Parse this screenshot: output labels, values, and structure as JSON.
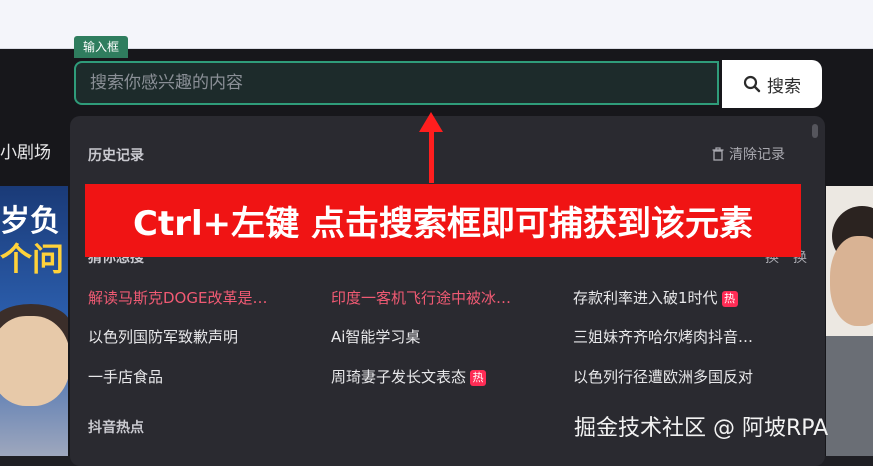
{
  "input_tag": "输入框",
  "search": {
    "placeholder": "搜索你感兴趣的内容",
    "button_label": "搜索"
  },
  "nav": {
    "partial_label": "小剧场"
  },
  "dropdown": {
    "history_title": "历史记录",
    "clear_label": "清除记录",
    "hot_title": "猜你想搜",
    "refresh_label": "换一换",
    "douyin_hot_title": "抖音热点",
    "hot_items": [
      {
        "text": "解读马斯克DOGE改革是…",
        "highlight": true,
        "badge": ""
      },
      {
        "text": "印度一客机飞行途中被冰…",
        "highlight": true,
        "badge": ""
      },
      {
        "text": "存款利率进入破1时代",
        "highlight": false,
        "badge": "热"
      },
      {
        "text": "以色列国防军致歉声明",
        "highlight": false,
        "badge": ""
      },
      {
        "text": "Ai智能学习桌",
        "highlight": false,
        "badge": ""
      },
      {
        "text": "三姐妹齐齐哈尔烤肉抖音…",
        "highlight": false,
        "badge": ""
      },
      {
        "text": "一手店食品",
        "highlight": false,
        "badge": ""
      },
      {
        "text": "周琦妻子发长文表态",
        "highlight": false,
        "badge": "热"
      },
      {
        "text": "以色列行径遭欧洲多国反对",
        "highlight": false,
        "badge": ""
      }
    ]
  },
  "thumbnails": {
    "left_text_1": "岁负",
    "left_text_2": "个问"
  },
  "annotation_banner": "Ctrl+左键 点击搜索框即可捕获到该元素",
  "watermark": "掘金技术社区 @ 阿坡RPA",
  "colors": {
    "accent_green": "#2f9c7a",
    "tag_green": "#2f7d5e",
    "banner_red": "#f01414",
    "highlight_red": "#f05a73",
    "hot_badge": "#fe2c55"
  }
}
